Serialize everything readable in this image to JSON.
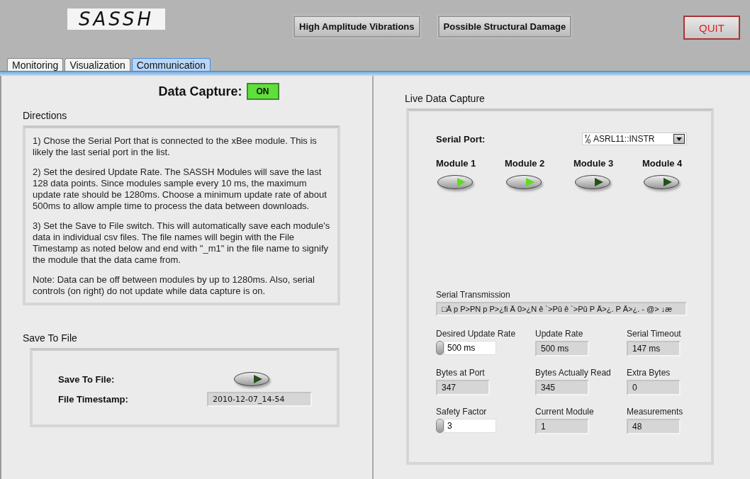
{
  "logo": "SASSH",
  "tabs": [
    {
      "label": "Monitoring",
      "selected": false
    },
    {
      "label": "Visualization",
      "selected": false
    },
    {
      "label": "Communication",
      "selected": true
    }
  ],
  "alerts": [
    {
      "label": "High Amplitude Vibrations"
    },
    {
      "label": "Possible Structural Damage"
    }
  ],
  "quit_button": "QUIT",
  "data_capture": {
    "label": "Data Capture:",
    "indicator": "ON",
    "on": true
  },
  "directions": {
    "title": "Directions",
    "paragraphs": [
      "1) Chose the Serial Port that is connected to the xBee module. This is likely the last serial port in the list.",
      "2) Set the desired Update Rate. The SASSH Modules will save the last 128 data points. Since modules sample every 10 ms, the maximum update rate should be 1280ms. Choose a minimum update rate of about 500ms to allow ample time to process the data between downloads.",
      "3) Set the Save to File switch. This will automatically save each module's data in individual csv files. The file names will begin with the File Timestamp as noted below and end with \"_m1\" in the file name to signify the module that the data came from.",
      "Note: Data can be off between modules by up to 1280ms. Also, serial controls (on right) do not update while data capture is on."
    ]
  },
  "save_to_file": {
    "title": "Save To File",
    "switch_label": "Save To File:",
    "lit": false,
    "timestamp_label": "File Timestamp:",
    "timestamp": "2010-12-07_14-54"
  },
  "live_capture": {
    "title": "Live Data Capture",
    "serial_port_label": "Serial Port:",
    "serial_port": "ASRL11::INSTR",
    "modules": [
      {
        "label": "Module 1",
        "lit": true
      },
      {
        "label": "Module 2",
        "lit": true
      },
      {
        "label": "Module 3",
        "lit": false
      },
      {
        "label": "Module 4",
        "lit": false
      }
    ],
    "transmission_label": "Serial Transmission",
    "transmission": "□Ä p P>PN p P>¿fi Ä 0>¿N ê `>Pû ê `>Pû P Ä>¿. P Ä>¿. - @> ↓æ",
    "fields": [
      {
        "label": "Desired Update Rate",
        "value": "500 ms",
        "kind": "control"
      },
      {
        "label": "Update Rate",
        "value": "500 ms",
        "kind": "indicator"
      },
      {
        "label": "Serial Timeout",
        "value": "147 ms",
        "kind": "indicator"
      },
      {
        "label": "Bytes at Port",
        "value": "347",
        "kind": "indicator"
      },
      {
        "label": "Bytes Actually Read",
        "value": "345",
        "kind": "indicator"
      },
      {
        "label": "Extra Bytes",
        "value": "0",
        "kind": "indicator"
      },
      {
        "label": "Safety Factor",
        "value": "3",
        "kind": "control"
      },
      {
        "label": "Current Module",
        "value": "1",
        "kind": "indicator"
      },
      {
        "label": "Measurements",
        "value": "48",
        "kind": "indicator"
      }
    ]
  }
}
